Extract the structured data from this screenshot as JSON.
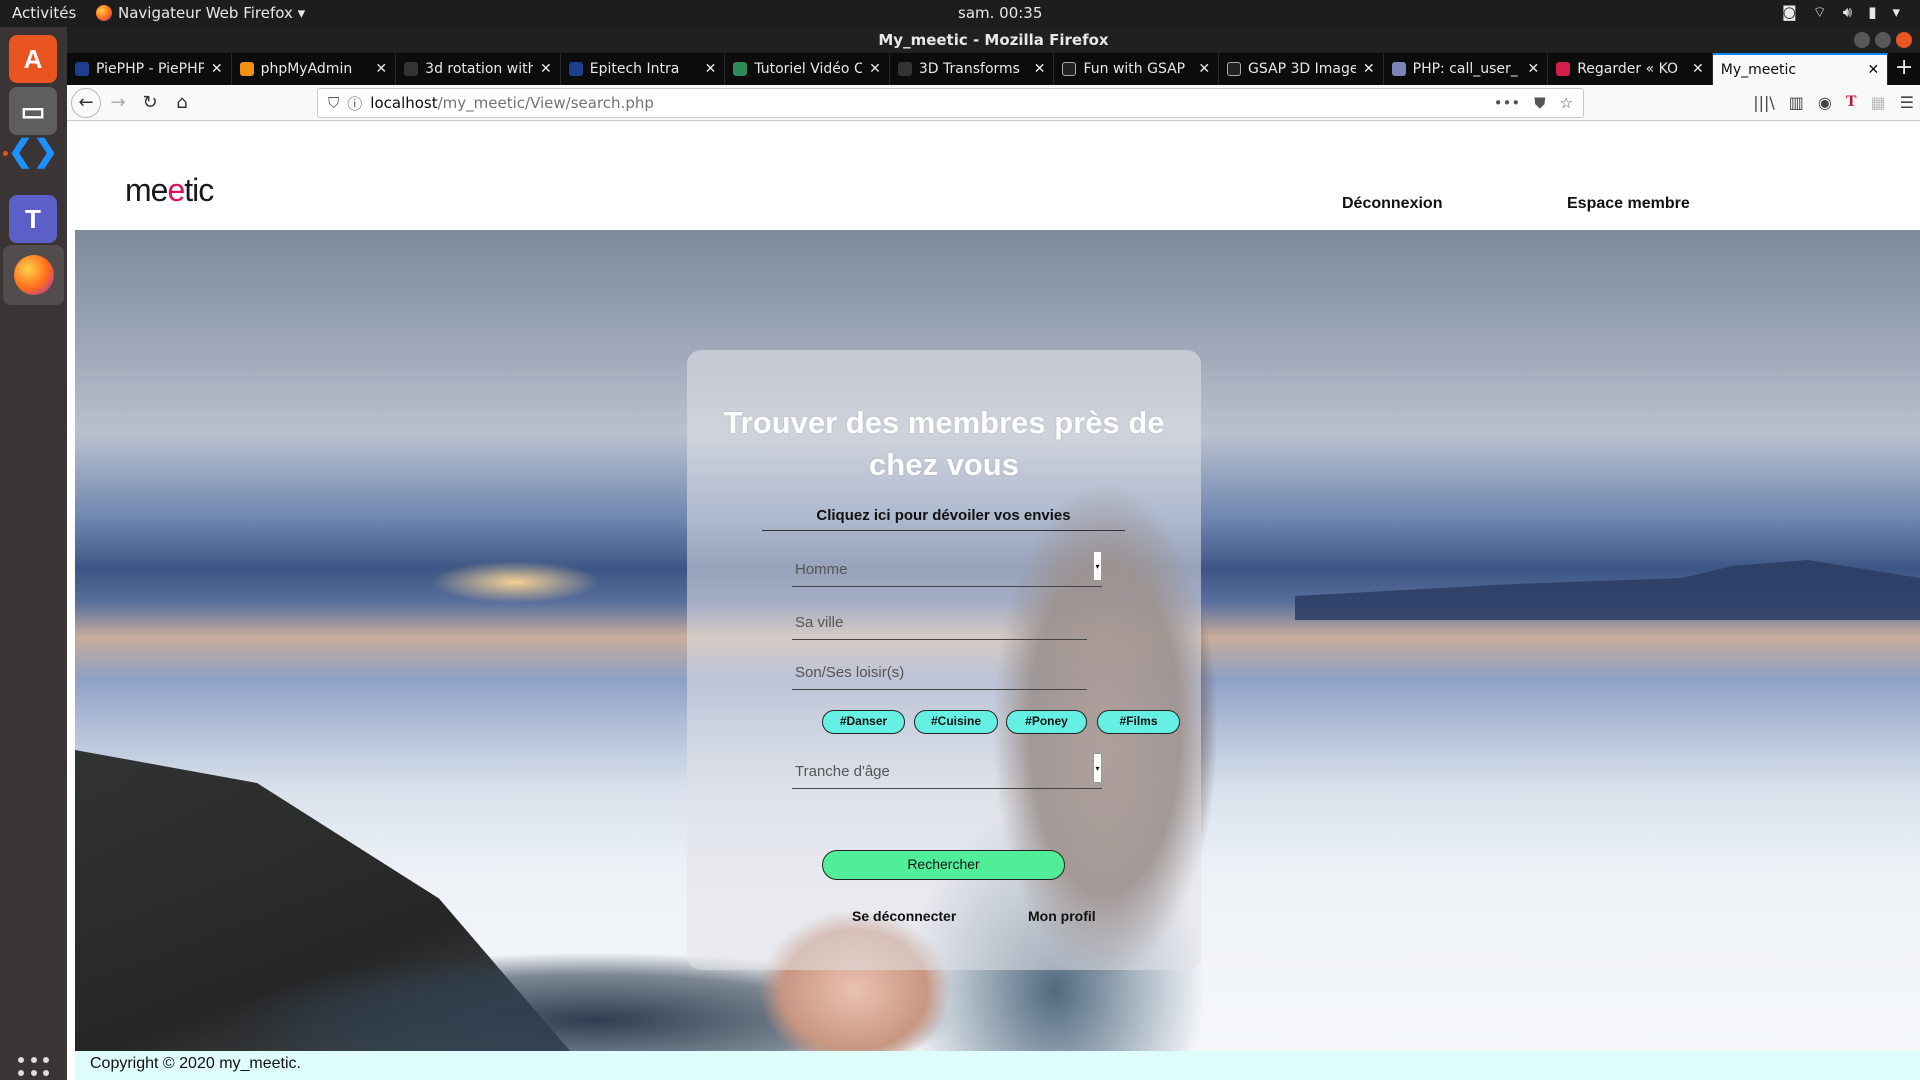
{
  "topbar": {
    "activities": "Activités",
    "app_menu": "Navigateur Web Firefox ▾",
    "clock": "sam. 00:35"
  },
  "dock": {
    "items": [
      {
        "name": "ubuntu-software-icon",
        "glyph": "A",
        "color": "#e95420"
      },
      {
        "name": "files-icon",
        "glyph": "▭",
        "color": "#6e6e6e"
      },
      {
        "name": "vscode-icon",
        "glyph": "❮❯",
        "color": "#0078d4"
      },
      {
        "name": "teams-icon",
        "glyph": "T",
        "color": "#5b5fc7"
      },
      {
        "name": "firefox-icon",
        "glyph": "●",
        "color": "#ff7a1a"
      }
    ]
  },
  "window": {
    "title": "My_meetic - Mozilla Firefox"
  },
  "tabs": [
    {
      "title": "PiePHP - PiePHP",
      "favicon_color": "#1e3f8f"
    },
    {
      "title": "phpMyAdmin",
      "favicon_color": "#f29111"
    },
    {
      "title": "3d rotation with",
      "favicon_color": "#333333"
    },
    {
      "title": "Epitech Intra",
      "favicon_color": "#1e3f8f"
    },
    {
      "title": "Tutoriel Vidéo C",
      "favicon_color": "#2e8b57"
    },
    {
      "title": "3D Transforms",
      "favicon_color": "#333333"
    },
    {
      "title": "Fun with GSAP",
      "favicon_color": "#222222"
    },
    {
      "title": "GSAP 3D Image",
      "favicon_color": "#222222"
    },
    {
      "title": "PHP: call_user_",
      "favicon_color": "#7a86b8"
    },
    {
      "title": "Regarder « KO",
      "favicon_color": "#d21f4a"
    },
    {
      "title": "My_meetic",
      "favicon_color": "#ffffff"
    }
  ],
  "navbar": {
    "url_host": "localhost",
    "url_path": "/my_meetic/View/search.php"
  },
  "site": {
    "logo_pre": "me",
    "logo_heart": "e",
    "logo_post": "tic",
    "nav_logout": "Déconnexion",
    "nav_member": "Espace membre"
  },
  "search_card": {
    "title": "Trouver des membres près de chez vous",
    "reveal_link": "Cliquez ici pour dévoiler vos envies",
    "gender_select": "Homme",
    "city_placeholder": "Sa ville",
    "hobbies_placeholder": "Son/Ses loisir(s)",
    "tags": [
      "#Danser",
      "#Cuisine",
      "#Poney",
      "#Films"
    ],
    "age_select": "Tranche d'âge",
    "search_button": "Rechercher",
    "logout_link": "Se déconnecter",
    "profile_link": "Mon profil"
  },
  "footer": {
    "copyright": "Copyright © 2020 my_meetic."
  }
}
